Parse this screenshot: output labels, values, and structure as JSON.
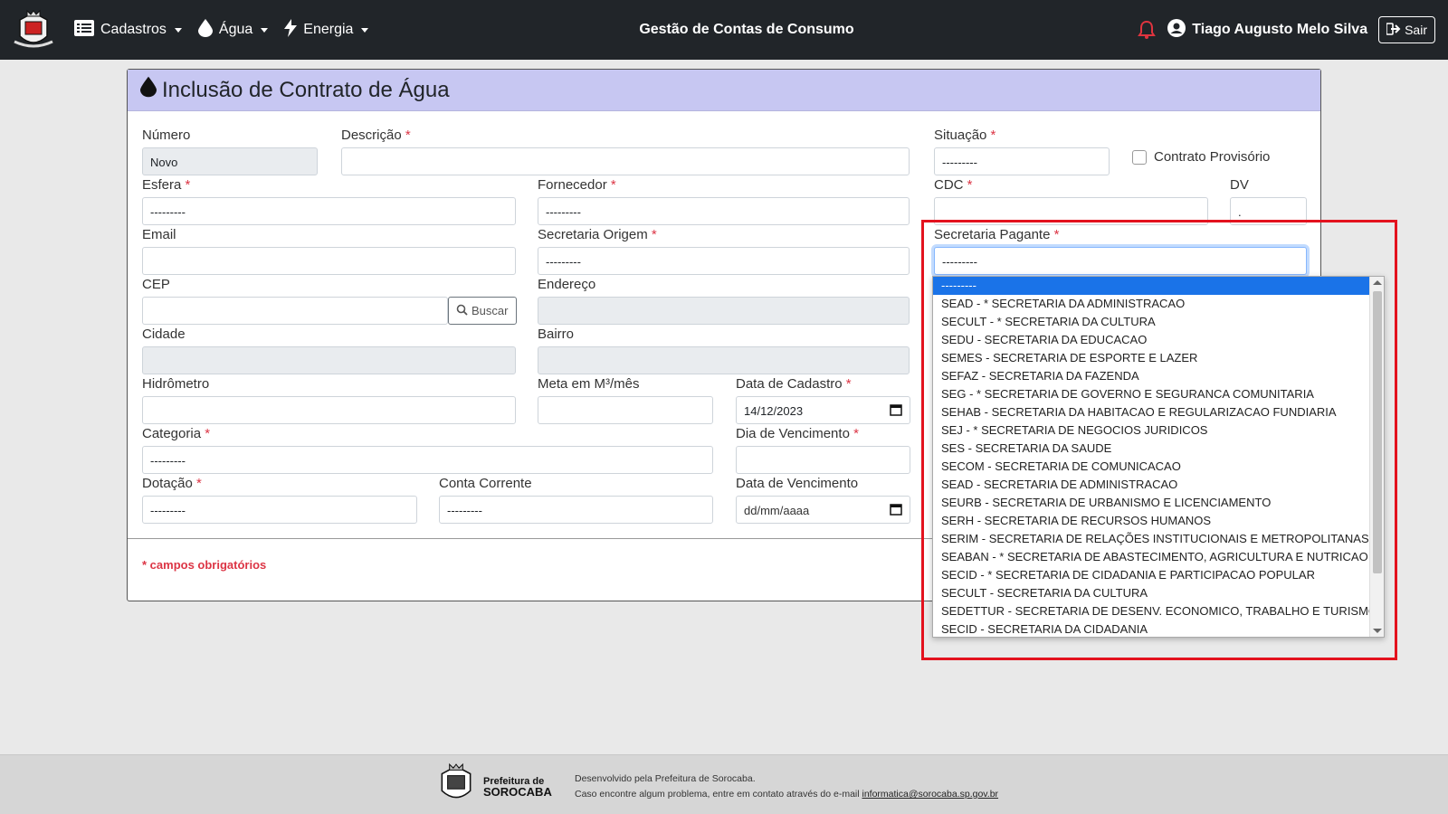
{
  "navbar": {
    "menu": [
      {
        "label": "Cadastros",
        "icon": "list-icon"
      },
      {
        "label": "Água",
        "icon": "water-drop-icon"
      },
      {
        "label": "Energia",
        "icon": "lightning-icon"
      }
    ],
    "title": "Gestão de Contas de Consumo",
    "user_name": "Tiago Augusto Melo Silva",
    "logout_label": "Sair"
  },
  "card": {
    "title": "Inclusão de Contrato de Água",
    "required_note": "* campos obrigatórios"
  },
  "form": {
    "numero": {
      "label": "Número",
      "value": "Novo"
    },
    "descricao": {
      "label": "Descrição",
      "value": ""
    },
    "situacao": {
      "label": "Situação",
      "value": "---------"
    },
    "contrato_provisorio": {
      "label": "Contrato Provisório",
      "checked": false
    },
    "esfera": {
      "label": "Esfera",
      "value": "---------"
    },
    "fornecedor": {
      "label": "Fornecedor",
      "value": "---------"
    },
    "cdc": {
      "label": "CDC",
      "value": ""
    },
    "dv": {
      "label": "DV",
      "value": "."
    },
    "email": {
      "label": "Email",
      "value": ""
    },
    "secretaria_origem": {
      "label": "Secretaria Origem",
      "value": "---------"
    },
    "secretaria_pagante": {
      "label": "Secretaria Pagante",
      "value": "---------"
    },
    "cep": {
      "label": "CEP",
      "value": "",
      "button": "Buscar"
    },
    "endereco": {
      "label": "Endereço",
      "value": ""
    },
    "cidade": {
      "label": "Cidade",
      "value": ""
    },
    "bairro": {
      "label": "Bairro",
      "value": ""
    },
    "hidrometro": {
      "label": "Hidrômetro",
      "value": ""
    },
    "meta": {
      "label": "Meta em M³/mês",
      "value": ""
    },
    "data_cadastro": {
      "label": "Data de Cadastro",
      "value": "14/12/2023"
    },
    "categoria": {
      "label": "Categoria",
      "value": "---------"
    },
    "dia_vencimento": {
      "label": "Dia de Vencimento",
      "value": ""
    },
    "dotacao": {
      "label": "Dotação",
      "value": "---------"
    },
    "conta_corrente": {
      "label": "Conta Corrente",
      "value": "---------"
    },
    "data_vencimento": {
      "label": "Data de Vencimento",
      "value": "dd/mm/aaaa"
    },
    "required_mark": "*"
  },
  "dropdown": {
    "options": [
      "---------",
      "SEAD - * SECRETARIA DA ADMINISTRACAO",
      "SECULT - * SECRETARIA DA CULTURA",
      "SEDU - SECRETARIA DA EDUCACAO",
      "SEMES - SECRETARIA DE ESPORTE E LAZER",
      "SEFAZ - SECRETARIA DA FAZENDA",
      "SEG - * SECRETARIA DE GOVERNO E SEGURANCA COMUNITARIA",
      "SEHAB - SECRETARIA DA HABITACAO E REGULARIZACAO FUNDIARIA",
      "SEJ - * SECRETARIA DE NEGOCIOS JURIDICOS",
      "SES - SECRETARIA DA SAUDE",
      "SECOM - SECRETARIA DE COMUNICACAO",
      "SEAD - SECRETARIA DE ADMINISTRACAO",
      "SEURB - SECRETARIA DE URBANISMO E LICENCIAMENTO",
      "SERH - SECRETARIA DE RECURSOS HUMANOS",
      "SERIM - SECRETARIA DE RELAÇÕES INSTITUCIONAIS E METROPOLITANAS",
      "SEABAN - * SECRETARIA DE ABASTECIMENTO, AGRICULTURA E NUTRICAO",
      "SECID - * SECRETARIA DE CIDADANIA E PARTICIPACAO POPULAR",
      "SECULT - SECRETARIA DA CULTURA",
      "SEDETTUR - SECRETARIA DE DESENV. ECONOMICO, TRABALHO E TURISMO",
      "SECID - SECRETARIA DA CIDADANIA"
    ],
    "selected_index": 0
  },
  "footer": {
    "logo_line1": "Prefeitura de",
    "logo_line2": "SOROCABA",
    "line1": "Desenvolvido pela Prefeitura de Sorocaba.",
    "line2_prefix": "Caso encontre algum problema, entre em contato através do e-mail ",
    "email": "informatica@sorocaba.sp.gov.br"
  },
  "colors": {
    "navbar": "#212529",
    "card_header": "#c7c7f2",
    "required": "#dc3545",
    "highlight": "#e3121e",
    "selected_option": "#1a73e8"
  }
}
